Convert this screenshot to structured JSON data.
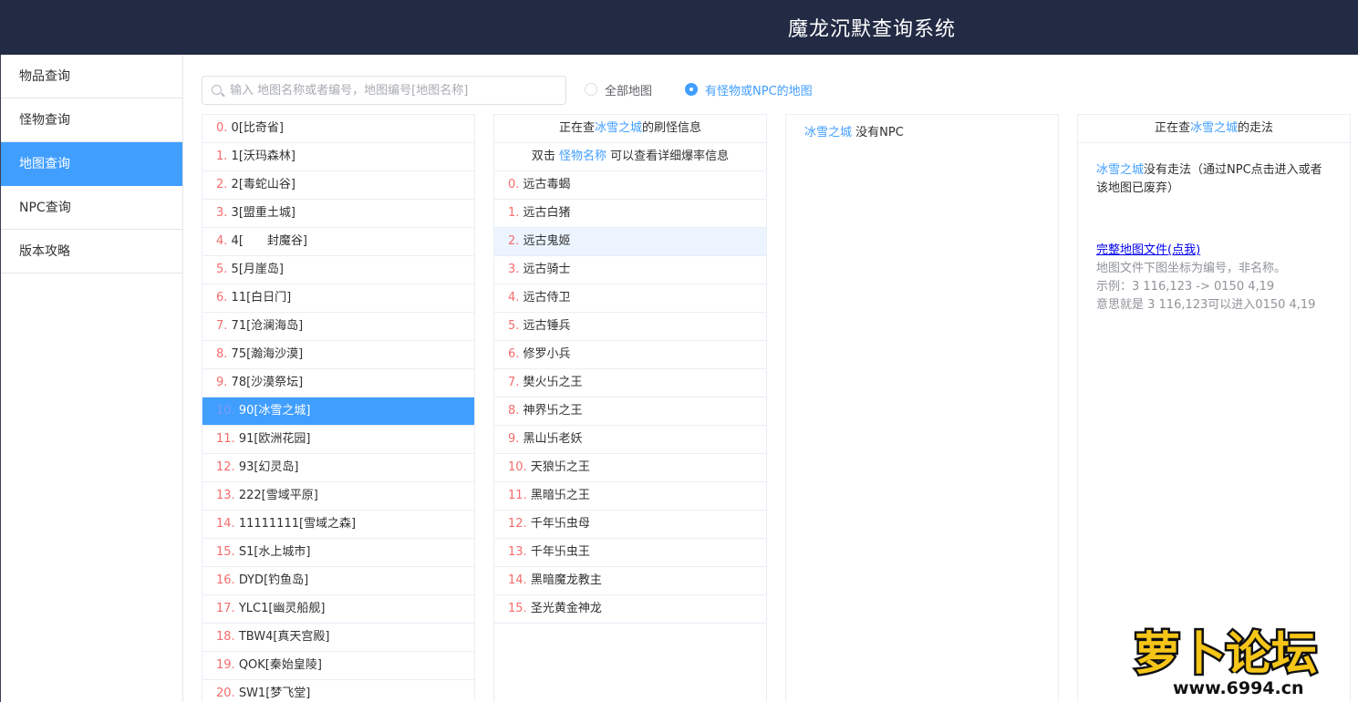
{
  "header": {
    "title": "魔龙沉默查询系统"
  },
  "sidebar": {
    "items": [
      {
        "label": "物品查询",
        "active": false
      },
      {
        "label": "怪物查询",
        "active": false
      },
      {
        "label": "地图查询",
        "active": true
      },
      {
        "label": "NPC查询",
        "active": false
      },
      {
        "label": "版本攻略",
        "active": false
      }
    ]
  },
  "search": {
    "placeholder": "输入 地图名称或者编号，地图编号[地图名称]",
    "value": ""
  },
  "filters": [
    {
      "label": "全部地图",
      "checked": false
    },
    {
      "label": "有怪物或NPC的地图",
      "checked": true
    }
  ],
  "maps": [
    {
      "idx": "0",
      "name": "0[比奇省]"
    },
    {
      "idx": "1",
      "name": "1[沃玛森林]"
    },
    {
      "idx": "2",
      "name": "2[毒蛇山谷]"
    },
    {
      "idx": "3",
      "name": "3[盟重土城]"
    },
    {
      "idx": "4",
      "name": "4[　　封魔谷]"
    },
    {
      "idx": "5",
      "name": "5[月崖岛]"
    },
    {
      "idx": "6",
      "name": "11[白日门]"
    },
    {
      "idx": "7",
      "name": "71[沧澜海岛]"
    },
    {
      "idx": "8",
      "name": "75[瀚海沙漠]"
    },
    {
      "idx": "9",
      "name": "78[沙漠祭坛]"
    },
    {
      "idx": "10",
      "name": "90[冰雪之城]"
    },
    {
      "idx": "11",
      "name": "91[欧洲花园]"
    },
    {
      "idx": "12",
      "name": "93[幻灵岛]"
    },
    {
      "idx": "13",
      "name": "222[雪域平原]"
    },
    {
      "idx": "14",
      "name": "11111111[雪域之森]"
    },
    {
      "idx": "15",
      "name": "S1[水上城市]"
    },
    {
      "idx": "16",
      "name": "DYD[钓鱼岛]"
    },
    {
      "idx": "17",
      "name": "YLC1[幽灵船舰]"
    },
    {
      "idx": "18",
      "name": "TBW4[真天宫殿]"
    },
    {
      "idx": "19",
      "name": "QOK[秦始皇陵]"
    },
    {
      "idx": "20",
      "name": "SW1[梦飞堂]"
    }
  ],
  "monsters": {
    "head_prefix": "正在查",
    "head_map": "冰雪之城",
    "head_suffix": "的刷怪信息",
    "tip_prefix": "双击 ",
    "tip_link": "怪物名称",
    "tip_suffix": " 可以查看详细爆率信息",
    "items": [
      {
        "idx": "0",
        "name": "远古毒蝎"
      },
      {
        "idx": "1",
        "name": "远古白猪"
      },
      {
        "idx": "2",
        "name": "远古鬼姬"
      },
      {
        "idx": "3",
        "name": "远古骑士"
      },
      {
        "idx": "4",
        "name": "远古侍卫"
      },
      {
        "idx": "5",
        "name": "远古锤兵"
      },
      {
        "idx": "6",
        "name": "修罗小兵"
      },
      {
        "idx": "7",
        "name": "樊火卐之王"
      },
      {
        "idx": "8",
        "name": "神界卐之王"
      },
      {
        "idx": "9",
        "name": "黑山卐老妖"
      },
      {
        "idx": "10",
        "name": "天狼卐之王"
      },
      {
        "idx": "11",
        "name": "黑暗卐之王"
      },
      {
        "idx": "12",
        "name": "千年卐虫母"
      },
      {
        "idx": "13",
        "name": "千年卐虫王"
      },
      {
        "idx": "14",
        "name": "黑暗魔龙教主"
      },
      {
        "idx": "15",
        "name": "圣光黄金神龙"
      }
    ]
  },
  "npc": {
    "map": "冰雪之城",
    "text": " 没有NPC"
  },
  "route": {
    "head_prefix": "正在查",
    "head_map": "冰雪之城",
    "head_suffix": "的走法",
    "map": "冰雪之城",
    "no_route": "没有走法（通过NPC点击进入或者该地图已废弃）",
    "file_link": "完整地图文件(点我)",
    "note1": "地图文件下图坐标为编号，非名称。",
    "note2": "示例：3 116,123 -> 0150 4,19",
    "note3": "意思就是 3 116,123可以进入0150 4,19"
  },
  "watermark": {
    "text": "萝卜论坛",
    "url": "www.6994.cn"
  }
}
